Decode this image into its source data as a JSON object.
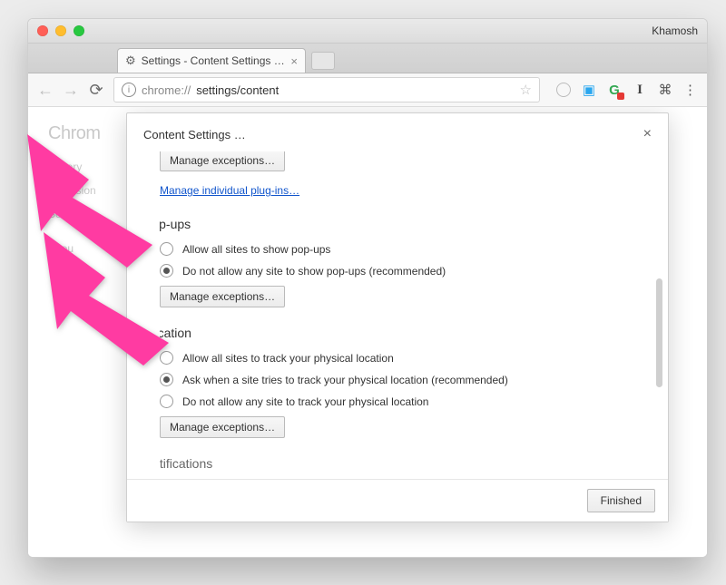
{
  "profile_name": "Khamosh",
  "tab": {
    "title": "Settings - Content Settings …"
  },
  "address": {
    "scheme": "chrome://",
    "rest": "settings/content"
  },
  "brand": "Chrom",
  "nav": {
    "history": "History",
    "extensions": "Extension",
    "settings": "Settings",
    "about": "Abou"
  },
  "modal": {
    "title": "Content Settings …",
    "top_button": "Manage exceptions…",
    "top_link": "Manage individual plug-ins…",
    "finished": "Finished",
    "sections": {
      "popups": {
        "heading": "Pop-ups",
        "opt1": "Allow all sites to show pop-ups",
        "opt2": "Do not allow any site to show pop-ups (recommended)",
        "manage": "Manage exceptions…"
      },
      "location": {
        "heading": "Location",
        "opt1": "Allow all sites to track your physical location",
        "opt2": "Ask when a site tries to track your physical location (recommended)",
        "opt3": "Do not allow any site to track your physical location",
        "manage": "Manage exceptions…"
      },
      "notifications": {
        "heading": "Notifications"
      }
    }
  },
  "icons": {
    "gear": "⚙"
  }
}
